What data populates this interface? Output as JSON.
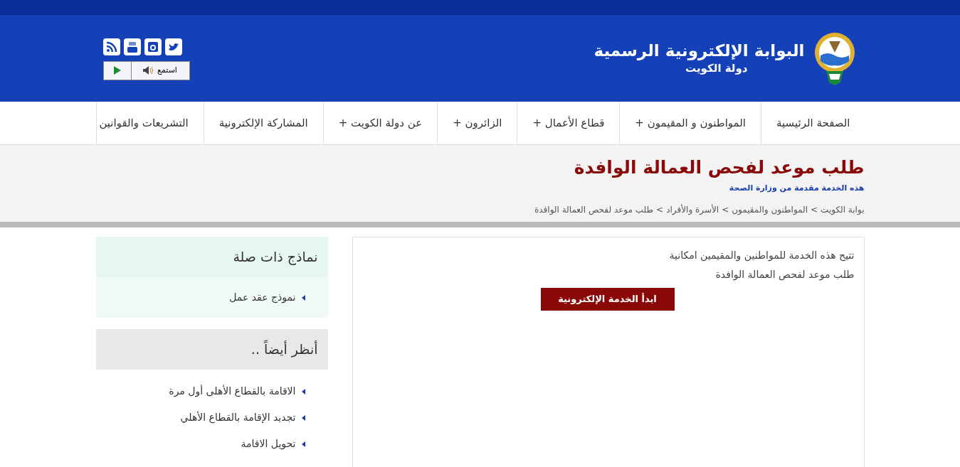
{
  "header": {
    "title": "البوابة الإلكترونية الرسمية",
    "subtitle": "دولة الكويت",
    "listen_label": "استمع"
  },
  "nav": [
    {
      "label": "الصفحة الرئيسية",
      "expandable": false
    },
    {
      "label": "المواطنون و المقيمون",
      "expandable": true
    },
    {
      "label": "قطاع الأعمال",
      "expandable": true
    },
    {
      "label": "الزائرون",
      "expandable": true
    },
    {
      "label": "عن دولة الكويت",
      "expandable": true
    },
    {
      "label": "المشاركة الإلكترونية",
      "expandable": false
    },
    {
      "label": "التشريعات والقوانين",
      "expandable": false
    }
  ],
  "expand_mark": "+",
  "page": {
    "title": "طلب موعد لفحص العمالة الوافدة",
    "provider": "هذه الخدمة مقدمة من وزارة الصحة",
    "breadcrumbs": [
      "بوابة الكويت",
      "المواطنون والمقيمون",
      "الأسرة والأفراد",
      "طلب موعد لفحص العمالة الوافدة"
    ],
    "separator": ">"
  },
  "main": {
    "lines": [
      "تتيح هذه الخدمة للمواطنين والمقيمين امكانية",
      "طلب موعد لفحص العمالة الوافدة"
    ],
    "button": "ابدأ الخدمة الإلكترونية"
  },
  "sidebar": [
    {
      "title": "نماذج ذات صلة",
      "kind": "forms",
      "items": [
        "نموذج عقد عمل"
      ]
    },
    {
      "title": "أنظر أيضاً ..",
      "kind": "see_also",
      "items": [
        "الاقامة بالقطاع الأهلى أول مرة",
        "تجديد الإقامة بالقطاع الأهلي",
        "تحويل الاقامة"
      ]
    }
  ]
}
